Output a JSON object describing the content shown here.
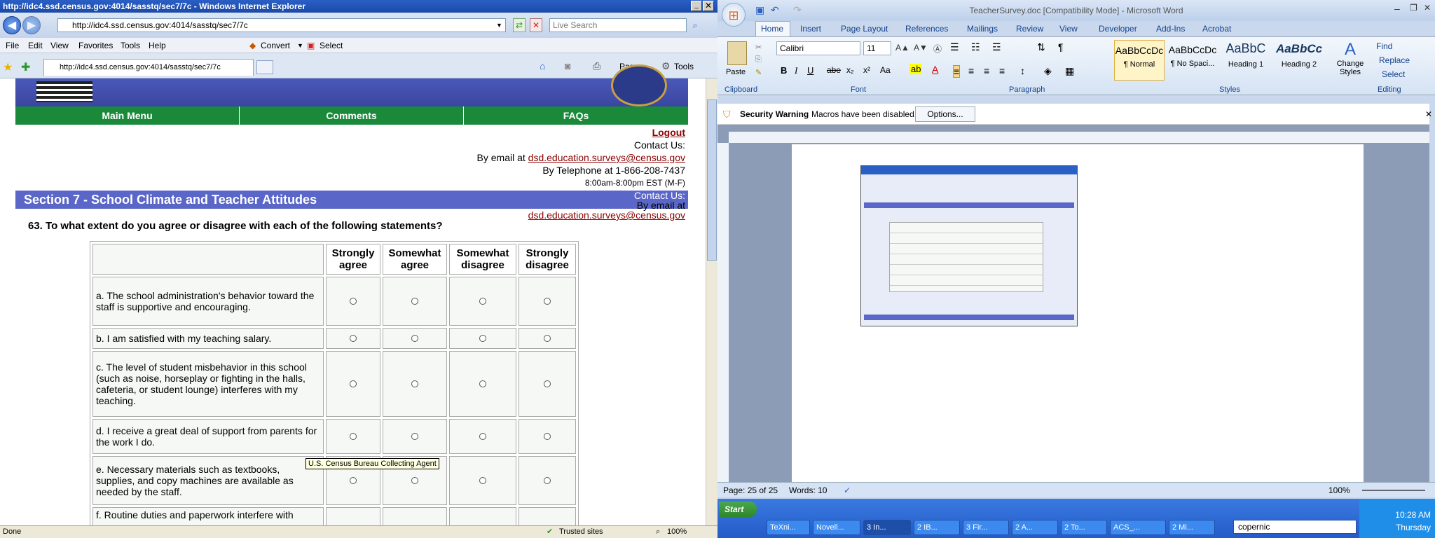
{
  "ie": {
    "title": "http://idc4.ssd.census.gov:4014/sasstq/sec7/7c - Windows Internet Explorer",
    "url": "http://idc4.ssd.census.gov:4014/sasstq/sec7/7c",
    "search_placeholder": "Live Search",
    "menu": [
      "File",
      "Edit",
      "View",
      "Favorites",
      "Tools",
      "Help"
    ],
    "convert_label": "Convert",
    "select_label": "Select",
    "tab_label": "http://idc4.ssd.census.gov:4014/sasstq/sec7/7c",
    "page_label": "Page",
    "tools_label": "Tools",
    "status_text": "Done",
    "zone_text": "Trusted sites",
    "zoom": "100%"
  },
  "page": {
    "nav": [
      "Main Menu",
      "Comments",
      "FAQs"
    ],
    "logout": "Logout",
    "contact_us": "Contact Us:",
    "by_email": "By email at",
    "email": "dsd.education.surveys@census.gov",
    "by_phone": "By Telephone at 1-866-208-7437",
    "hours": "8:00am-8:00pm EST (M-F)",
    "contact_us2": "Contact Us:",
    "by_email2": "By email at",
    "email2": "dsd.education.surveys@census.gov",
    "section_title": "Section 7 - School Climate and Teacher Attitudes",
    "question": "63. To what extent do you agree or disagree with each of the following statements?",
    "columns": [
      "Strongly agree",
      "Somewhat agree",
      "Somewhat disagree",
      "Strongly disagree"
    ],
    "rows": [
      "a. The school administration's behavior toward the staff is supportive and encouraging.",
      "b. I am satisfied with my teaching salary.",
      "c. The level of student misbehavior in this school (such as noise, horseplay or fighting in the halls, cafeteria, or student lounge) interferes with my teaching.",
      "d. I receive a great deal of support from parents for the work I do.",
      "e. Necessary materials such as textbooks, supplies, and copy machines are available as needed by the staff.",
      "f. Routine duties and paperwork interfere with"
    ],
    "tooltip": "U.S. Census Bureau Collecting Agent"
  },
  "word": {
    "title": "TeacherSurvey.doc [Compatibility Mode] - Microsoft Word",
    "tabs": [
      "Home",
      "Insert",
      "Page Layout",
      "References",
      "Mailings",
      "Review",
      "View",
      "Developer",
      "Add-Ins",
      "Acrobat"
    ],
    "font": "Calibri",
    "size": "11",
    "paste": "Paste",
    "groups": [
      "Clipboard",
      "Font",
      "Paragraph",
      "Styles",
      "Editing"
    ],
    "styles": [
      {
        "preview": "AaBbCcDc",
        "name": "¶ Normal"
      },
      {
        "preview": "AaBbCcDc",
        "name": "¶ No Spaci..."
      },
      {
        "preview": "AaBbC",
        "name": "Heading 1"
      },
      {
        "preview": "AaBbCc",
        "name": "Heading 2"
      }
    ],
    "change_styles": "Change Styles",
    "find": "Find",
    "replace": "Replace",
    "select": "Select",
    "security_title": "Security Warning",
    "security_msg": "Macros have been disabled.",
    "options_btn": "Options...",
    "page_status": "Page: 25 of 25",
    "words_status": "Words: 10",
    "zoom": "100%"
  },
  "taskbar": {
    "start": "Start",
    "items": [
      "TeXni...",
      "Novell...",
      "3 In...",
      "2 IB...",
      "3 Fir...",
      "2 A...",
      "2 To...",
      "ACS_...",
      "2 Mi..."
    ],
    "search": "copernic",
    "time": "10:28 AM",
    "day": "Thursday"
  }
}
